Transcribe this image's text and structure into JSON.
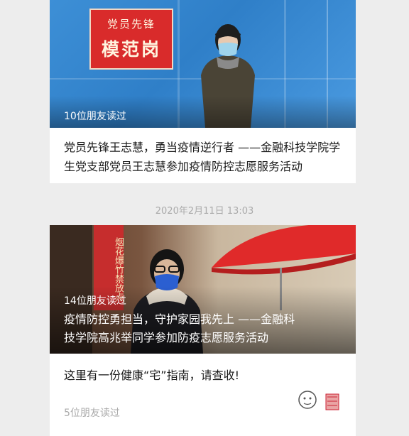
{
  "articles": [
    {
      "hero": {
        "sign_line1": "党员先锋",
        "sign_line2": "模范岗"
      },
      "read_count": "10位朋友读过",
      "title": "党员先锋王志慧，勇当疫情逆行者 ——金融科技学院学生党支部党员王志慧参加疫情防控志愿服务活动"
    }
  ],
  "date_divider": "2020年2月11日 13:03",
  "group2": {
    "hero": {
      "banner_text": "烟花爆竹禁放点",
      "read_count": "14位朋友读过",
      "title_line1": "疫情防控勇担当，守护家园我先上 ——金融科",
      "title_line2": "技学院高兆举同学参加防疫志愿服务活动"
    },
    "sub_article": {
      "title": "这里有一份健康“宅”指南，请查收!",
      "read_count": "5位朋友读过"
    }
  },
  "colors": {
    "background": "#ededed",
    "card": "#ffffff",
    "meta_text": "#aaaaaa"
  }
}
